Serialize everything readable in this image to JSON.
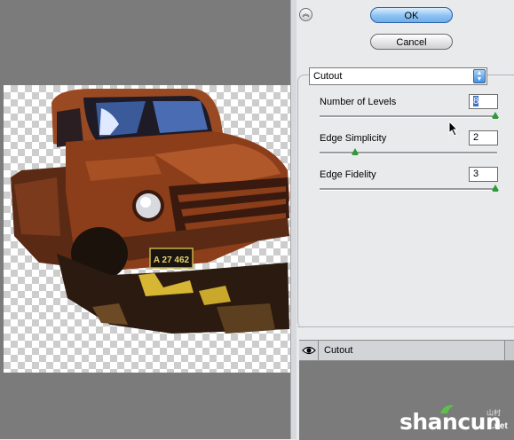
{
  "dialog": {
    "ok_label": "OK",
    "cancel_label": "Cancel",
    "collapse_icon": "chevron-double-up-icon"
  },
  "filter": {
    "selected": "Cutout"
  },
  "params": [
    {
      "label": "Number of Levels",
      "value": "8",
      "slider_fraction": 1.0
    },
    {
      "label": "Edge Simplicity",
      "value": "2",
      "slider_fraction": 0.2
    },
    {
      "label": "Edge Fidelity",
      "value": "3",
      "slider_fraction": 1.0
    }
  ],
  "layers": [
    {
      "name": "Cutout",
      "visible": true
    }
  ],
  "preview": {
    "license_plate": "A 27 462"
  },
  "watermark": {
    "text": "shancun",
    "cn": "山村",
    "suffix": ".net"
  },
  "colors": {
    "accent": "#3a6fc4",
    "truck_rust": "#8a3c1a",
    "slider_thumb": "#2f9a3a"
  }
}
